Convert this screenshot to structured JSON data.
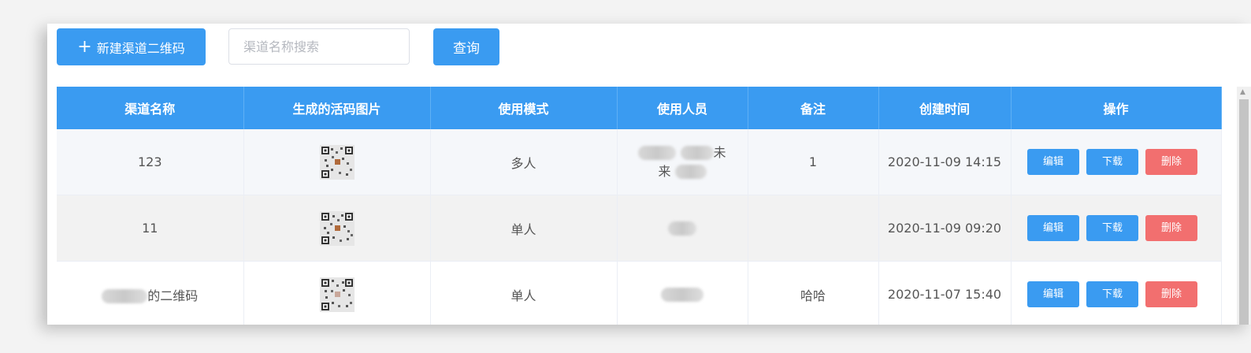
{
  "toolbar": {
    "new_button_icon": "plus-icon",
    "new_button_label": "新建渠道二维码",
    "search_placeholder": "渠道名称搜索",
    "query_button_label": "查询"
  },
  "colors": {
    "primary": "#3a9bf1",
    "danger": "#f26f6f",
    "row_stripe": "#f5f7fa"
  },
  "table": {
    "headers": [
      "渠道名称",
      "生成的活码图片",
      "使用模式",
      "使用人员",
      "备注",
      "创建时间",
      "操作"
    ],
    "rows": [
      {
        "name": "123",
        "qr": "qr-code-image",
        "mode": "多人",
        "users_visible_text": "未来",
        "note": "1",
        "created": "2020-11-09 14:15"
      },
      {
        "name": "11",
        "qr": "qr-code-image",
        "mode": "单人",
        "users_visible_text": "",
        "note": "",
        "created": "2020-11-09 09:20"
      },
      {
        "name_suffix": "的二维码",
        "qr": "qr-code-image",
        "mode": "单人",
        "users_visible_text": "",
        "note": "哈哈",
        "created": "2020-11-07 15:40"
      }
    ],
    "actions": {
      "edit": "编辑",
      "download": "下载",
      "delete": "删除"
    }
  }
}
